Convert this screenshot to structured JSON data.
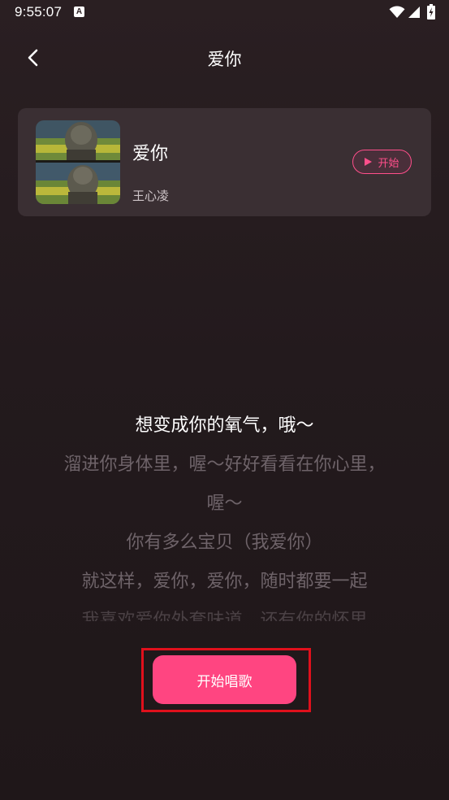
{
  "status_bar": {
    "time": "9:55:07",
    "notification_letter": "A"
  },
  "header": {
    "title": "爱你"
  },
  "song": {
    "title": "爱你",
    "artist": "王心凌",
    "start_label": "开始"
  },
  "lyrics": [
    "想变成你的氧气，哦～",
    "溜进你身体里，喔～好好看看在你心里，",
    "喔～",
    "你有多么宝贝（我爱你）",
    "就这样，爱你，爱你，随时都要一起",
    "我喜欢爱你外套味道，还有你的怀里"
  ],
  "actions": {
    "sing_label": "开始唱歌"
  },
  "colors": {
    "accent": "#ff4581",
    "highlight_box": "#e0101c"
  }
}
